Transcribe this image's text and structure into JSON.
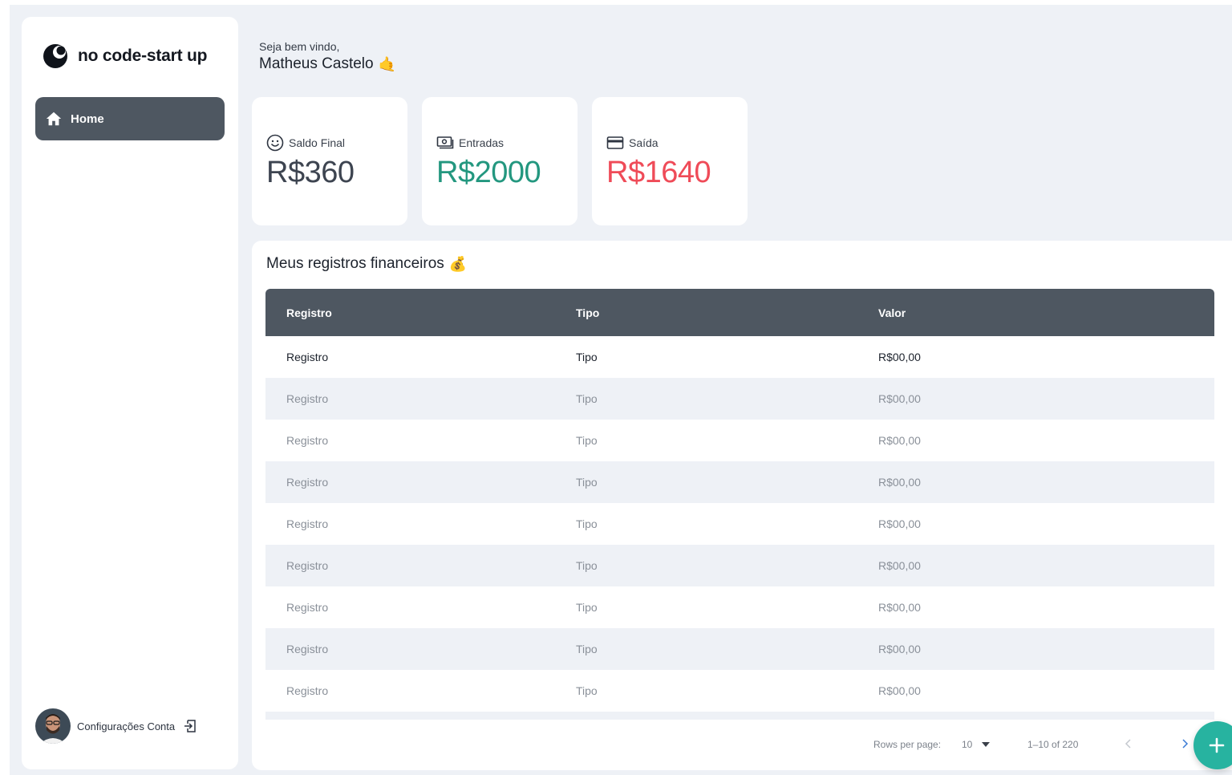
{
  "brand": {
    "name": "no code-start up"
  },
  "sidebar": {
    "home_label": "Home",
    "account_label": "Configurações Conta"
  },
  "header": {
    "greeting": "Seja bem vindo,",
    "user_name": "Matheus Castelo",
    "emoji": "🤙"
  },
  "cards": [
    {
      "label": "Saldo Final",
      "value": "R$360",
      "icon": "smile-icon",
      "color": "#3d4450"
    },
    {
      "label": "Entradas",
      "value": "R$2000",
      "icon": "cash-icon",
      "color": "#23977f"
    },
    {
      "label": "Saída",
      "value": "R$1640",
      "icon": "credit-card-icon",
      "color": "#ef4b58"
    }
  ],
  "records": {
    "title": "Meus registros financeiros",
    "emoji": "💰",
    "columns": [
      "Registro",
      "Tipo",
      "Valor"
    ],
    "rows": [
      [
        "Registro",
        "Tipo",
        "R$00,00"
      ],
      [
        "Registro",
        "Tipo",
        "R$00,00"
      ],
      [
        "Registro",
        "Tipo",
        "R$00,00"
      ],
      [
        "Registro",
        "Tipo",
        "R$00,00"
      ],
      [
        "Registro",
        "Tipo",
        "R$00,00"
      ],
      [
        "Registro",
        "Tipo",
        "R$00,00"
      ],
      [
        "Registro",
        "Tipo",
        "R$00,00"
      ],
      [
        "Registro",
        "Tipo",
        "R$00,00"
      ],
      [
        "Registro",
        "Tipo",
        "R$00,00"
      ]
    ]
  },
  "pagination": {
    "rows_per_page_label": "Rows per page:",
    "rows_per_page": "10",
    "range": "1–10 of 220"
  },
  "colors": {
    "accent": "#27b3a0",
    "sidebar_active": "#4e5761",
    "background": "#eef1f6"
  }
}
